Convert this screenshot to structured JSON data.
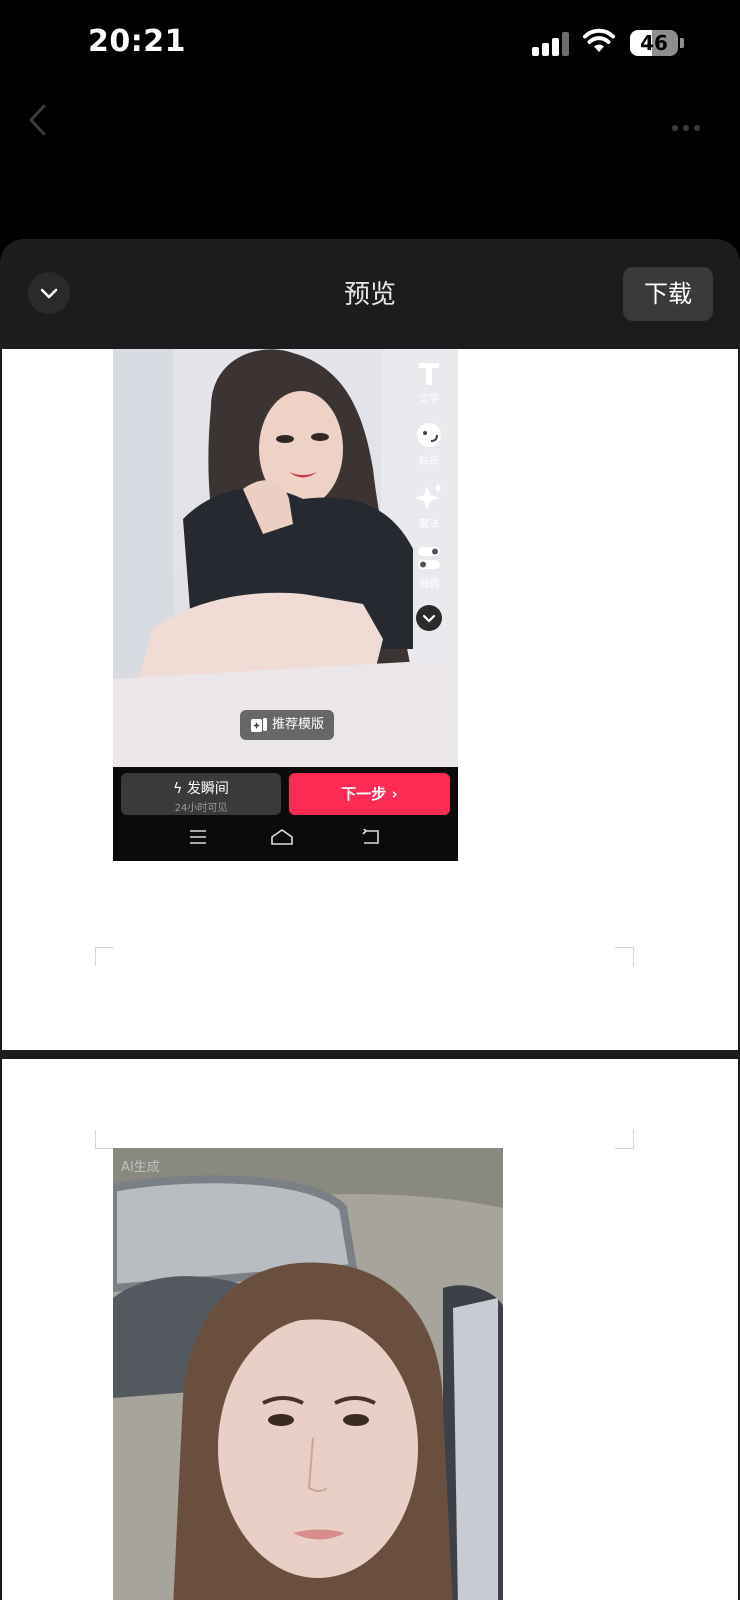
{
  "status_bar": {
    "time": "20:21",
    "battery": "46",
    "battery_level": 0.46
  },
  "sheet": {
    "title": "预览",
    "download_label": "下载"
  },
  "screenshot1": {
    "tools": [
      {
        "icon": "text-tool-icon",
        "label": "文字"
      },
      {
        "icon": "sticker-tool-icon",
        "label": "贴纸"
      },
      {
        "icon": "magic-tool-icon",
        "label": "魔法"
      },
      {
        "icon": "adjust-tool-icon",
        "label": "细调"
      }
    ],
    "template_label": "推荐模版",
    "moment_label": "发瞬间",
    "moment_sub": "24小时可见",
    "next_label": "下一步"
  },
  "screenshot2": {
    "ai_label": "AI生成"
  },
  "colors": {
    "accent": "#fe2c55",
    "sheet_bg": "#1c1c1e",
    "download_bg": "#3a3a3c"
  }
}
